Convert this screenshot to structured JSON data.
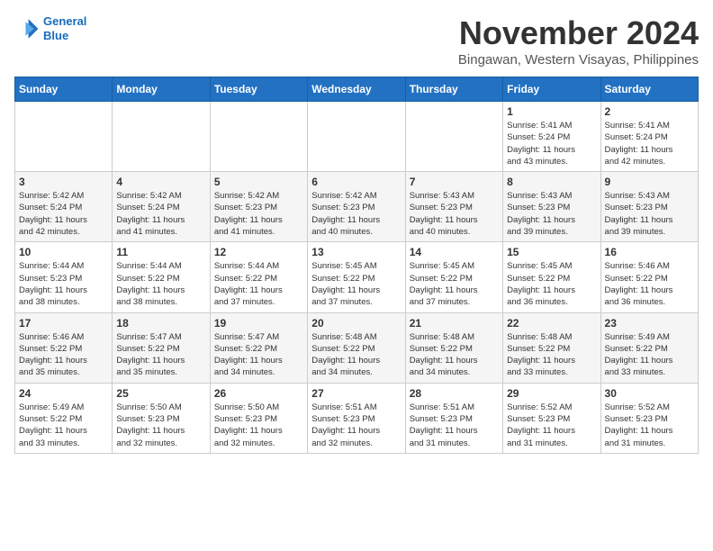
{
  "header": {
    "logo_line1": "General",
    "logo_line2": "Blue",
    "month": "November 2024",
    "location": "Bingawan, Western Visayas, Philippines"
  },
  "weekdays": [
    "Sunday",
    "Monday",
    "Tuesday",
    "Wednesday",
    "Thursday",
    "Friday",
    "Saturday"
  ],
  "weeks": [
    [
      {
        "day": "",
        "info": ""
      },
      {
        "day": "",
        "info": ""
      },
      {
        "day": "",
        "info": ""
      },
      {
        "day": "",
        "info": ""
      },
      {
        "day": "",
        "info": ""
      },
      {
        "day": "1",
        "info": "Sunrise: 5:41 AM\nSunset: 5:24 PM\nDaylight: 11 hours\nand 43 minutes."
      },
      {
        "day": "2",
        "info": "Sunrise: 5:41 AM\nSunset: 5:24 PM\nDaylight: 11 hours\nand 42 minutes."
      }
    ],
    [
      {
        "day": "3",
        "info": "Sunrise: 5:42 AM\nSunset: 5:24 PM\nDaylight: 11 hours\nand 42 minutes."
      },
      {
        "day": "4",
        "info": "Sunrise: 5:42 AM\nSunset: 5:24 PM\nDaylight: 11 hours\nand 41 minutes."
      },
      {
        "day": "5",
        "info": "Sunrise: 5:42 AM\nSunset: 5:23 PM\nDaylight: 11 hours\nand 41 minutes."
      },
      {
        "day": "6",
        "info": "Sunrise: 5:42 AM\nSunset: 5:23 PM\nDaylight: 11 hours\nand 40 minutes."
      },
      {
        "day": "7",
        "info": "Sunrise: 5:43 AM\nSunset: 5:23 PM\nDaylight: 11 hours\nand 40 minutes."
      },
      {
        "day": "8",
        "info": "Sunrise: 5:43 AM\nSunset: 5:23 PM\nDaylight: 11 hours\nand 39 minutes."
      },
      {
        "day": "9",
        "info": "Sunrise: 5:43 AM\nSunset: 5:23 PM\nDaylight: 11 hours\nand 39 minutes."
      }
    ],
    [
      {
        "day": "10",
        "info": "Sunrise: 5:44 AM\nSunset: 5:23 PM\nDaylight: 11 hours\nand 38 minutes."
      },
      {
        "day": "11",
        "info": "Sunrise: 5:44 AM\nSunset: 5:22 PM\nDaylight: 11 hours\nand 38 minutes."
      },
      {
        "day": "12",
        "info": "Sunrise: 5:44 AM\nSunset: 5:22 PM\nDaylight: 11 hours\nand 37 minutes."
      },
      {
        "day": "13",
        "info": "Sunrise: 5:45 AM\nSunset: 5:22 PM\nDaylight: 11 hours\nand 37 minutes."
      },
      {
        "day": "14",
        "info": "Sunrise: 5:45 AM\nSunset: 5:22 PM\nDaylight: 11 hours\nand 37 minutes."
      },
      {
        "day": "15",
        "info": "Sunrise: 5:45 AM\nSunset: 5:22 PM\nDaylight: 11 hours\nand 36 minutes."
      },
      {
        "day": "16",
        "info": "Sunrise: 5:46 AM\nSunset: 5:22 PM\nDaylight: 11 hours\nand 36 minutes."
      }
    ],
    [
      {
        "day": "17",
        "info": "Sunrise: 5:46 AM\nSunset: 5:22 PM\nDaylight: 11 hours\nand 35 minutes."
      },
      {
        "day": "18",
        "info": "Sunrise: 5:47 AM\nSunset: 5:22 PM\nDaylight: 11 hours\nand 35 minutes."
      },
      {
        "day": "19",
        "info": "Sunrise: 5:47 AM\nSunset: 5:22 PM\nDaylight: 11 hours\nand 34 minutes."
      },
      {
        "day": "20",
        "info": "Sunrise: 5:48 AM\nSunset: 5:22 PM\nDaylight: 11 hours\nand 34 minutes."
      },
      {
        "day": "21",
        "info": "Sunrise: 5:48 AM\nSunset: 5:22 PM\nDaylight: 11 hours\nand 34 minutes."
      },
      {
        "day": "22",
        "info": "Sunrise: 5:48 AM\nSunset: 5:22 PM\nDaylight: 11 hours\nand 33 minutes."
      },
      {
        "day": "23",
        "info": "Sunrise: 5:49 AM\nSunset: 5:22 PM\nDaylight: 11 hours\nand 33 minutes."
      }
    ],
    [
      {
        "day": "24",
        "info": "Sunrise: 5:49 AM\nSunset: 5:22 PM\nDaylight: 11 hours\nand 33 minutes."
      },
      {
        "day": "25",
        "info": "Sunrise: 5:50 AM\nSunset: 5:23 PM\nDaylight: 11 hours\nand 32 minutes."
      },
      {
        "day": "26",
        "info": "Sunrise: 5:50 AM\nSunset: 5:23 PM\nDaylight: 11 hours\nand 32 minutes."
      },
      {
        "day": "27",
        "info": "Sunrise: 5:51 AM\nSunset: 5:23 PM\nDaylight: 11 hours\nand 32 minutes."
      },
      {
        "day": "28",
        "info": "Sunrise: 5:51 AM\nSunset: 5:23 PM\nDaylight: 11 hours\nand 31 minutes."
      },
      {
        "day": "29",
        "info": "Sunrise: 5:52 AM\nSunset: 5:23 PM\nDaylight: 11 hours\nand 31 minutes."
      },
      {
        "day": "30",
        "info": "Sunrise: 5:52 AM\nSunset: 5:23 PM\nDaylight: 11 hours\nand 31 minutes."
      }
    ]
  ]
}
